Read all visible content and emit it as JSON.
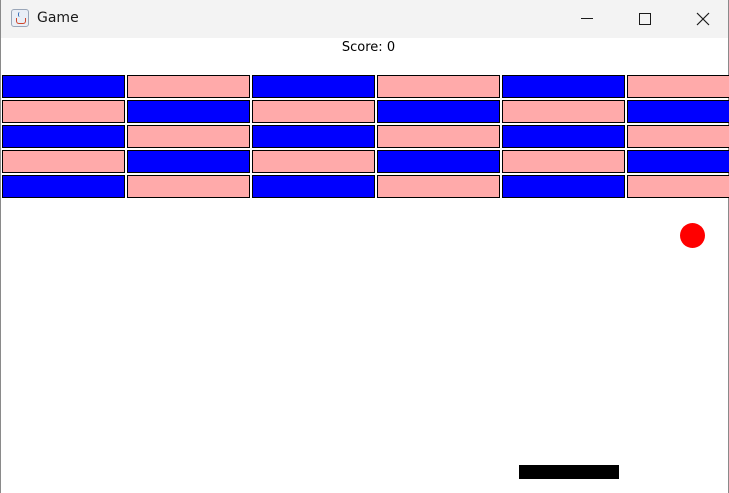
{
  "window": {
    "title": "Game",
    "app_icon": "java-cup-icon",
    "controls": [
      "minimize-icon",
      "maximize-icon",
      "close-icon"
    ]
  },
  "game": {
    "score_text": "Score: 0",
    "brick_grid": {
      "rows": 5,
      "cols": 6
    },
    "colors": {
      "blue_brick": "#0000ff",
      "pink_brick": "#ffaaaa",
      "ball": "#ff0000",
      "paddle": "#000000"
    },
    "row_patterns": [
      [
        "blue",
        "pink",
        "blue",
        "pink",
        "blue",
        "pink"
      ],
      [
        "pink",
        "blue",
        "pink",
        "blue",
        "pink",
        "blue"
      ],
      [
        "blue",
        "pink",
        "blue",
        "pink",
        "blue",
        "pink"
      ],
      [
        "pink",
        "blue",
        "pink",
        "blue",
        "pink",
        "blue"
      ],
      [
        "blue",
        "pink",
        "blue",
        "pink",
        "blue",
        "pink"
      ]
    ]
  }
}
